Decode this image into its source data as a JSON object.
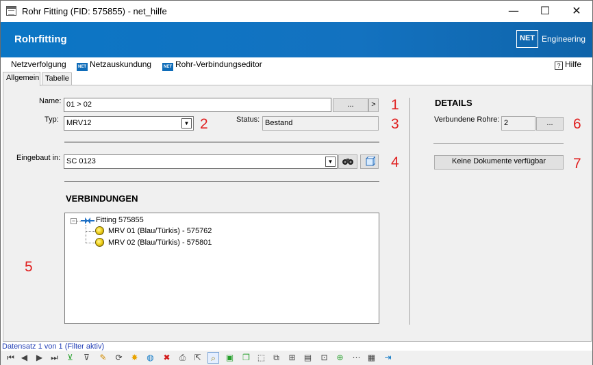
{
  "window": {
    "title": "Rohr Fitting (FID: 575855) - net_hilfe",
    "minimize": "—",
    "maximize": "☐",
    "close": "✕"
  },
  "header": {
    "title": "Rohrfitting",
    "logo_text": "NET",
    "logo_caption": "Engineering"
  },
  "menu": {
    "items": [
      "Netzverfolgung",
      "Netzauskundung",
      "Rohr-Verbindungseditor"
    ],
    "icon_text": "NET",
    "help": "Hilfe",
    "help_icon": "?"
  },
  "tabs": [
    "Allgemein",
    "Tabelle"
  ],
  "form": {
    "name_label": "Name:",
    "name_value": "01 > 02",
    "name_browse": "...",
    "name_next": ">",
    "typ_label": "Typ:",
    "typ_value": "MRV12",
    "status_label": "Status:",
    "status_value": "Bestand",
    "eingebaut_label": "Eingebaut in:",
    "eingebaut_value": "SC 0123",
    "dropdown_arrow": "▼"
  },
  "connections": {
    "heading": "VERBINDUNGEN",
    "root": "Fitting 575855",
    "children": [
      "MRV 01 (Blau/Türkis) - 575762",
      "MRV 02 (Blau/Türkis) - 575801"
    ],
    "expander": "−"
  },
  "details": {
    "heading": "DETAILS",
    "verbundene_label": "Verbundene Rohre:",
    "verbundene_value": "2",
    "verbundene_button": "...",
    "docs_button": "Keine Dokumente verfügbar"
  },
  "annotations": [
    "1",
    "2",
    "3",
    "4",
    "5",
    "6",
    "7"
  ],
  "status_bar": {
    "text": "Datensatz 1 von 1 (Filter aktiv)"
  },
  "toolbar": {
    "icons": [
      {
        "name": "first-record-icon",
        "glyph": "⏮"
      },
      {
        "name": "prev-record-icon",
        "glyph": "◀"
      },
      {
        "name": "next-record-icon",
        "glyph": "▶"
      },
      {
        "name": "last-record-icon",
        "glyph": "⏭"
      },
      {
        "name": "add-filter-icon",
        "glyph": "⊻"
      },
      {
        "name": "filter-icon",
        "glyph": "⊽"
      },
      {
        "name": "edit-icon",
        "glyph": "✎"
      },
      {
        "name": "refresh-icon",
        "glyph": "⟳"
      },
      {
        "name": "new-icon",
        "glyph": "✸"
      },
      {
        "name": "globe-icon",
        "glyph": "◍"
      },
      {
        "name": "delete-icon",
        "glyph": "✖"
      },
      {
        "name": "print-icon",
        "glyph": "⎙"
      },
      {
        "name": "select-icon",
        "glyph": "⇱"
      },
      {
        "name": "zoom-icon",
        "glyph": "⌕"
      },
      {
        "name": "layer-icon",
        "glyph": "▣"
      },
      {
        "name": "copy-shape-icon",
        "glyph": "❐"
      },
      {
        "name": "select-area-icon",
        "glyph": "⬚"
      },
      {
        "name": "duplicate-icon",
        "glyph": "⧉"
      },
      {
        "name": "new-folder-icon",
        "glyph": "⊞"
      },
      {
        "name": "report-icon",
        "glyph": "▤"
      },
      {
        "name": "document-icon",
        "glyph": "⊡"
      },
      {
        "name": "add-document-icon",
        "glyph": "⊕"
      },
      {
        "name": "connect-icon",
        "glyph": "⋯"
      },
      {
        "name": "table-icon",
        "glyph": "▦"
      },
      {
        "name": "exit-icon",
        "glyph": "⇥"
      }
    ],
    "colors": {
      "accent": "#0b76c5",
      "status_text": "#1f3cb5",
      "annotation": "#e02020",
      "delete": "#d21c1c",
      "green": "#27a02c"
    }
  }
}
